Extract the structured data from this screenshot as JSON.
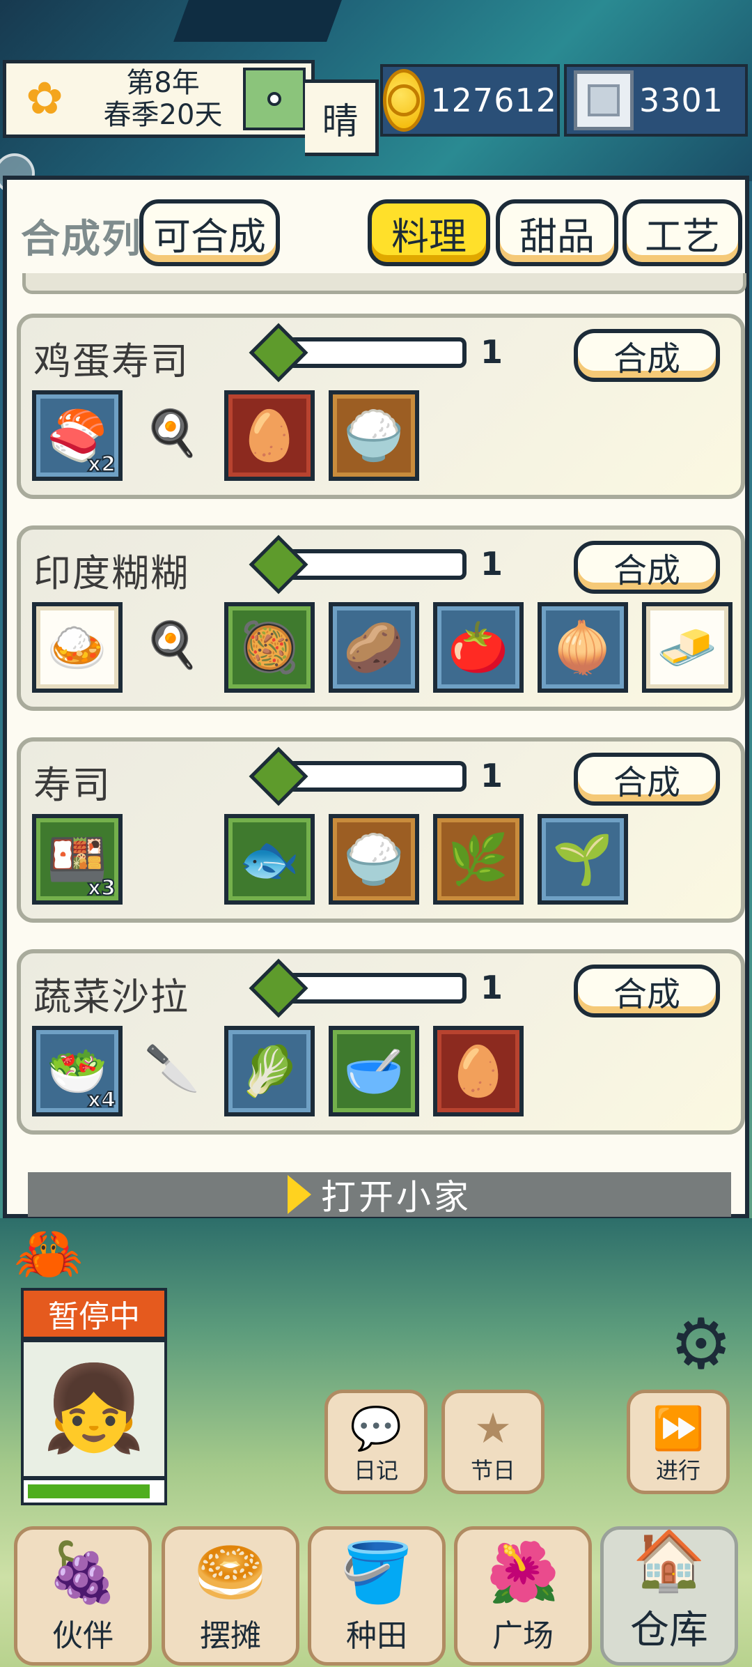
{
  "hud": {
    "date_line1": "第8年",
    "date_line2": "春季20天",
    "weather": "晴",
    "coins": "127612",
    "gems": "3301",
    "icons": {
      "flower": "flower-icon",
      "coin": "coin-icon",
      "gem": "gem-icon"
    }
  },
  "panel": {
    "title": "合成列表",
    "tabs": [
      {
        "label": "可合成",
        "active": false
      },
      {
        "label": "料理",
        "active": true
      },
      {
        "label": "甜品",
        "active": false
      },
      {
        "label": "工艺",
        "active": false
      }
    ],
    "craft_label": "合成",
    "recipes": [
      {
        "name": "鸡蛋寿司",
        "count": "1",
        "result_qty": "x2",
        "tool": "frying-pan-icon",
        "ingredients": [
          "egg",
          "rice"
        ]
      },
      {
        "name": "印度糊糊",
        "count": "1",
        "result_qty": "",
        "tool": "frying-pan-icon",
        "ingredients": [
          "curry-base",
          "potato",
          "tomato",
          "onion",
          "butter"
        ]
      },
      {
        "name": "寿司",
        "count": "1",
        "result_qty": "x3",
        "tool": "",
        "ingredients": [
          "fish",
          "rice",
          "seaweed",
          "herb"
        ]
      },
      {
        "name": "蔬菜沙拉",
        "count": "1",
        "result_qty": "x4",
        "tool": "knife-icon",
        "ingredients": [
          "cabbage",
          "salad-bowl",
          "egg"
        ]
      }
    ],
    "open_home_label": "打开小家"
  },
  "scene": {
    "paused_label": "暂停中",
    "hp_percent": 92,
    "mid_buttons": [
      {
        "label": "日记",
        "icon": "chat-icon"
      },
      {
        "label": "节日",
        "icon": "star-icon"
      },
      {
        "label": "进行",
        "icon": "fast-forward-icon"
      }
    ],
    "nav": [
      {
        "label": "伙伴",
        "icon": "grapes-icon",
        "active": false
      },
      {
        "label": "摆摊",
        "icon": "bread-icon",
        "active": false
      },
      {
        "label": "种田",
        "icon": "watering-can-icon",
        "active": false
      },
      {
        "label": "广场",
        "icon": "hibiscus-icon",
        "active": false
      },
      {
        "label": "仓库",
        "icon": "house-icon",
        "active": true
      }
    ]
  }
}
